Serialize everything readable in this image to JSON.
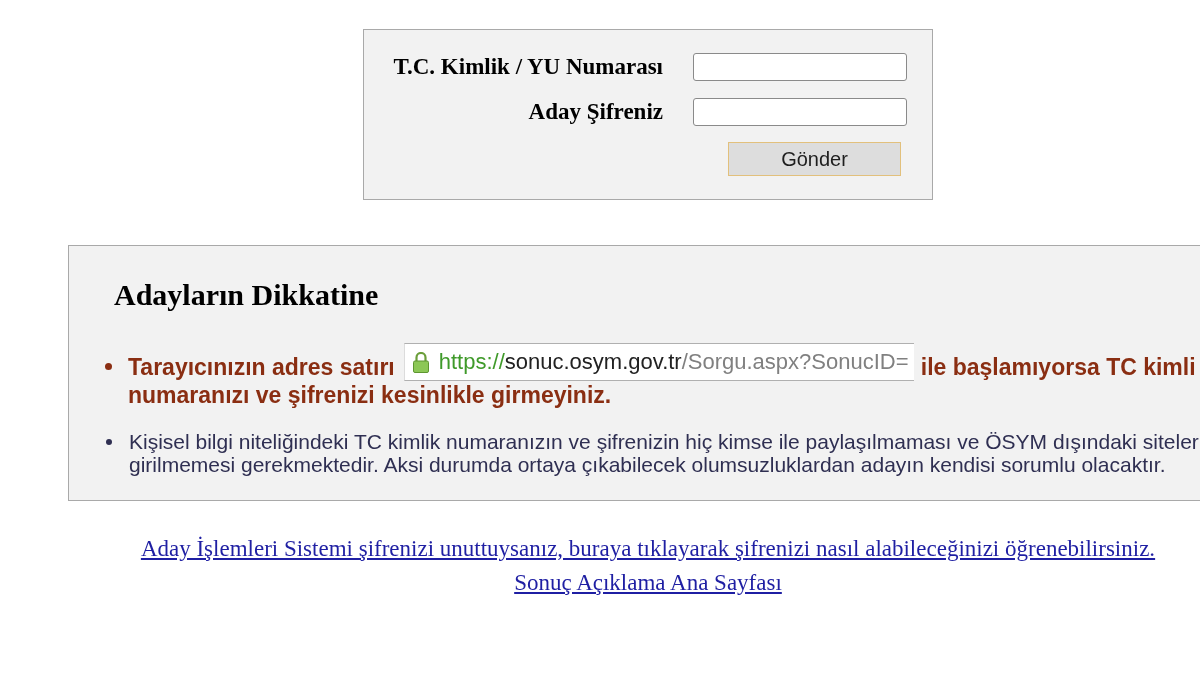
{
  "login_form": {
    "fields": [
      {
        "label": "T.C. Kimlik / YU Numarası"
      },
      {
        "label": "Aday Şifreniz"
      }
    ],
    "submit_button": "Gönder"
  },
  "notice": {
    "title": "Adayların Dikkatine",
    "items": [
      {
        "kind": "warning",
        "text_before": "Tarayıcınızın adres satırı",
        "address_bar": {
          "scheme": "https://",
          "host": "sonuc.osym.gov.tr",
          "path": "/Sorgu.aspx?SonucID="
        },
        "text_after": "ile başlamıyorsa TC kimli",
        "line_2": "numaranızı ve şifrenizi kesinlikle girmeyiniz."
      },
      {
        "kind": "info",
        "lines": [
          "Kişisel bilgi niteliğindeki TC kimlik numaranızın ve şifrenizin hiç kimse ile paylaşılmaması ve ÖSYM dışındaki siteler",
          "girilmemesi gerekmektedir. Aksi durumda ortaya çıkabilecek olumsuzluklardan adayın kendisi sorumlu olacaktır."
        ]
      }
    ]
  },
  "links": [
    "Aday İşlemleri Sistemi şifrenizi unuttuysanız, buraya tıklayarak şifrenizi nasıl alabileceğinizi öğrenebilirsiniz.",
    "Sonuç Açıklama Ana Sayfası"
  ]
}
